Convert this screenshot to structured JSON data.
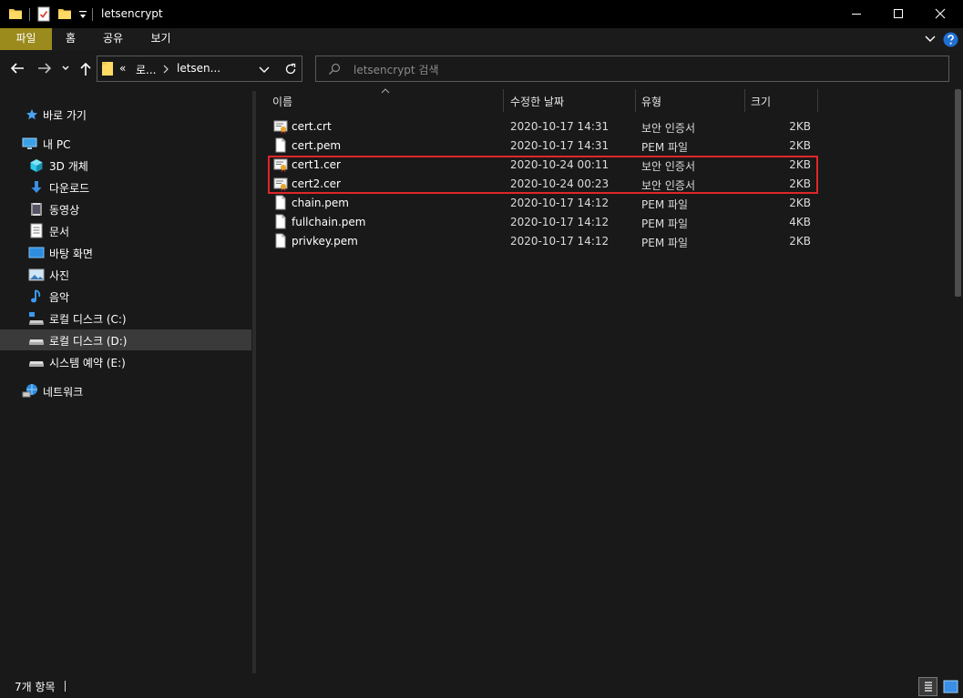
{
  "window": {
    "title": "letsencrypt"
  },
  "ribbon": {
    "tabs": [
      "파일",
      "홈",
      "공유",
      "보기"
    ]
  },
  "address": {
    "crumb1": "«",
    "crumb2": "로...",
    "crumb3": "letsen..."
  },
  "search": {
    "placeholder": "letsencrypt 검색"
  },
  "sidebar": {
    "items": [
      {
        "label": "바로 가기",
        "icon": "star-icon"
      },
      {
        "label": "내 PC",
        "icon": "pc-icon"
      },
      {
        "label": "3D 개체",
        "icon": "cube-3d-icon"
      },
      {
        "label": "다운로드",
        "icon": "download-icon"
      },
      {
        "label": "동영상",
        "icon": "video-icon"
      },
      {
        "label": "문서",
        "icon": "document-icon"
      },
      {
        "label": "바탕 화면",
        "icon": "desktop-icon"
      },
      {
        "label": "사진",
        "icon": "picture-icon"
      },
      {
        "label": "음악",
        "icon": "music-icon"
      },
      {
        "label": "로컬 디스크 (C:)",
        "icon": "system-drive-icon"
      },
      {
        "label": "로컬 디스크 (D:)",
        "icon": "drive-icon",
        "selected": true
      },
      {
        "label": "시스템 예약 (E:)",
        "icon": "drive-icon"
      },
      {
        "label": "네트워크",
        "icon": "network-icon"
      }
    ]
  },
  "columns": {
    "name": "이름",
    "modified": "수정한 날짜",
    "type": "유형",
    "size": "크기"
  },
  "files": [
    {
      "name": "cert.crt",
      "modified": "2020-10-17 14:31",
      "type": "보안 인증서",
      "size": "2KB",
      "icon": "certificate-icon"
    },
    {
      "name": "cert.pem",
      "modified": "2020-10-17 14:31",
      "type": "PEM 파일",
      "size": "2KB",
      "icon": "file-icon"
    },
    {
      "name": "cert1.cer",
      "modified": "2020-10-24 00:11",
      "type": "보안 인증서",
      "size": "2KB",
      "icon": "certificate-icon"
    },
    {
      "name": "cert2.cer",
      "modified": "2020-10-24 00:23",
      "type": "보안 인증서",
      "size": "2KB",
      "icon": "certificate-icon"
    },
    {
      "name": "chain.pem",
      "modified": "2020-10-17 14:12",
      "type": "PEM 파일",
      "size": "2KB",
      "icon": "file-icon"
    },
    {
      "name": "fullchain.pem",
      "modified": "2020-10-17 14:12",
      "type": "PEM 파일",
      "size": "4KB",
      "icon": "file-icon"
    },
    {
      "name": "privkey.pem",
      "modified": "2020-10-17 14:12",
      "type": "PEM 파일",
      "size": "2KB",
      "icon": "file-icon"
    }
  ],
  "status": {
    "count": "7개 항목"
  },
  "colors": {
    "file_tab": "#9b8a1c",
    "highlight": "#e0262a",
    "background": "#191919",
    "selected": "#3a3a3a"
  }
}
